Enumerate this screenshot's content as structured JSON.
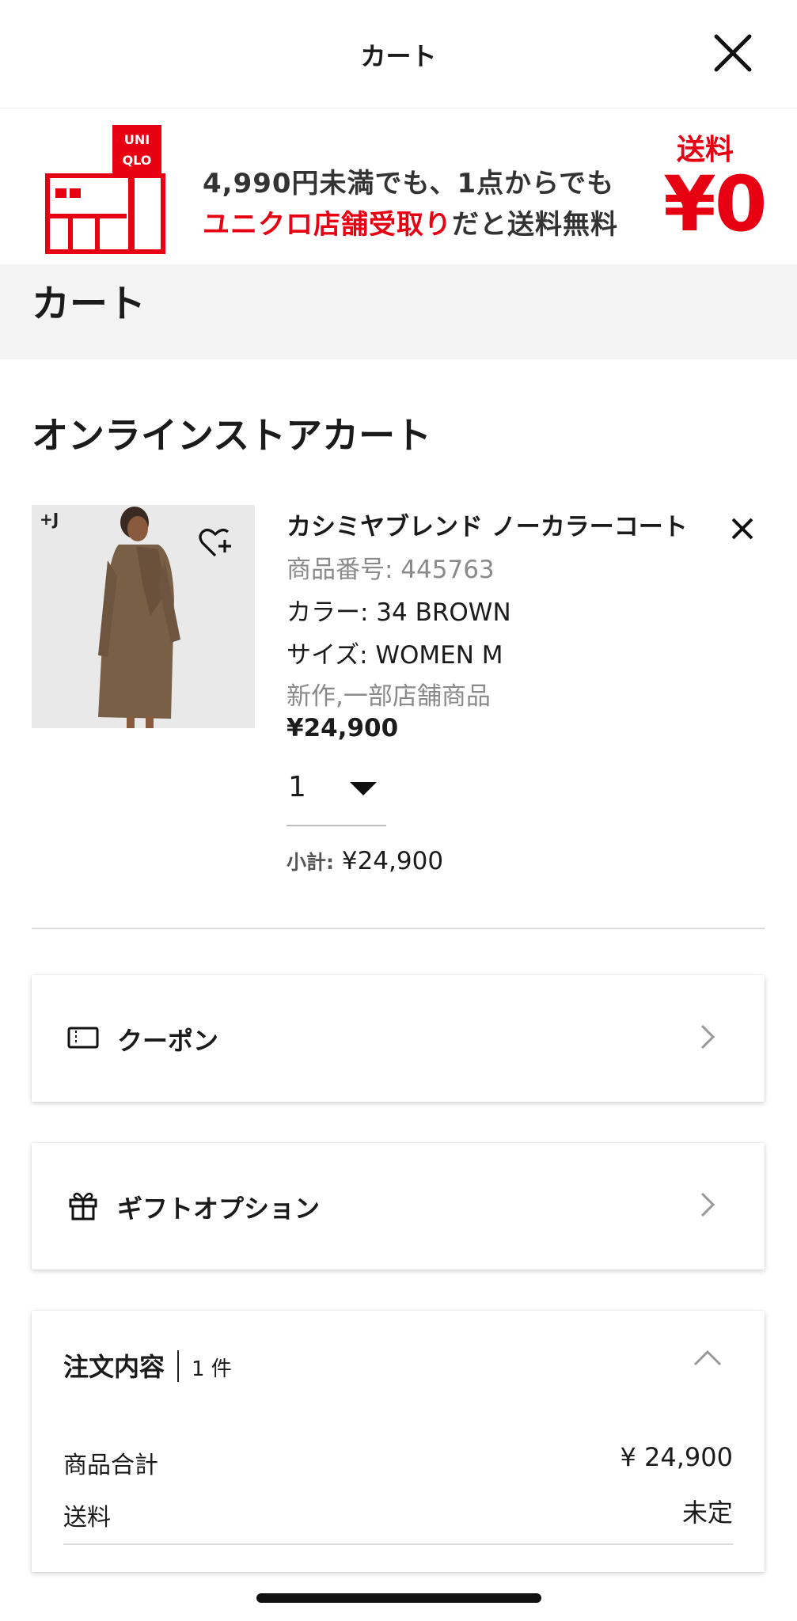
{
  "modal": {
    "title": "カート"
  },
  "banner": {
    "logo_text": "UNIQLO",
    "line1": "4,990円未満でも、1点からでも",
    "line2_red": "ユニクロ店舗受取り",
    "line2_rest": "だと送料無料",
    "shipping_label": "送料",
    "shipping_price": "¥0",
    "brand_color": "#e60012"
  },
  "page": {
    "title": "カート",
    "section_heading": "オンラインストアカート"
  },
  "product": {
    "badge": "+J",
    "name": "カシミヤブレンド ノーカラーコート",
    "number": "商品番号: 445763",
    "color": "カラー: 34 BROWN",
    "size": "サイズ: WOMEN M",
    "tags": "新作,一部店舗商品",
    "price": "¥24,900",
    "quantity": "1",
    "subtotal_label": "小計:",
    "subtotal_value": "¥24,900"
  },
  "coupon": {
    "label": "クーポン"
  },
  "gift": {
    "label": "ギフトオプション"
  },
  "order": {
    "title": "注文内容",
    "count": "1 件",
    "rows": [
      {
        "label": "商品合計",
        "value": "¥ 24,900"
      },
      {
        "label": "送料",
        "value": "未定"
      }
    ]
  },
  "icons": [
    "close-icon",
    "wishlist-heart-plus-icon",
    "remove-item-icon",
    "coupon-ticket-icon",
    "gift-icon",
    "chevron-right-icon",
    "chevron-up-icon",
    "uniqlo-store-logo"
  ]
}
